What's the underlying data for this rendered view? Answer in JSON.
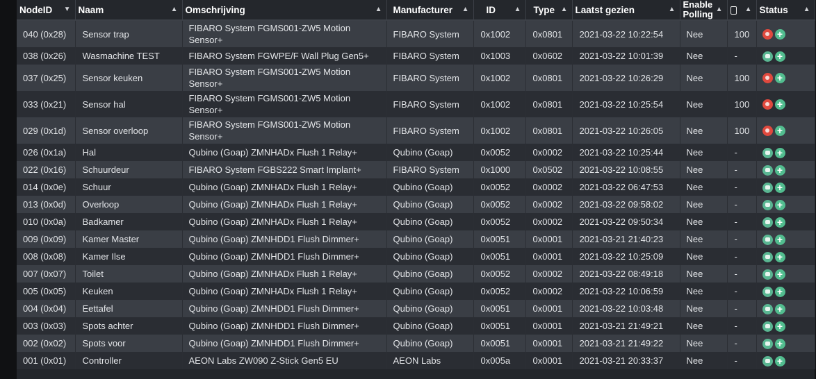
{
  "headers": {
    "nodeid": "NodeID",
    "naam": "Naam",
    "omschrijving": "Omschrijving",
    "manufacturer": "Manufacturer",
    "id": "ID",
    "type": "Type",
    "laatst": "Laatst gezien",
    "polling": "Enable Polling",
    "battery_icon": "battery-icon",
    "status": "Status"
  },
  "icons": {
    "sort": "sort-arrow-icon",
    "status_asleep": "status-warning-icon",
    "status_alive": "status-ok-icon",
    "add": "plus-circle-icon"
  },
  "colors": {
    "warning": "#e0493e",
    "ok": "#5ab692",
    "add": "#52bd8f"
  },
  "rows": [
    {
      "nodeid": "040 (0x28)",
      "naam": "Sensor trap",
      "omschrijving": "FIBARO System FGMS001-ZW5 Motion Sensor+",
      "manufacturer": "FIBARO System",
      "id": "0x1002",
      "type": "0x0801",
      "laatst": "2021-03-22 10:22:54",
      "polling": "Nee",
      "battery": "100",
      "status": "warn"
    },
    {
      "nodeid": "038 (0x26)",
      "naam": "Wasmachine TEST",
      "omschrijving": "FIBARO System FGWPE/F Wall Plug Gen5+",
      "manufacturer": "FIBARO System",
      "id": "0x1003",
      "type": "0x0602",
      "laatst": "2021-03-22 10:01:39",
      "polling": "Nee",
      "battery": "-",
      "status": "ok"
    },
    {
      "nodeid": "037 (0x25)",
      "naam": "Sensor keuken",
      "omschrijving": "FIBARO System FGMS001-ZW5 Motion Sensor+",
      "manufacturer": "FIBARO System",
      "id": "0x1002",
      "type": "0x0801",
      "laatst": "2021-03-22 10:26:29",
      "polling": "Nee",
      "battery": "100",
      "status": "warn"
    },
    {
      "nodeid": "033 (0x21)",
      "naam": "Sensor hal",
      "omschrijving": "FIBARO System FGMS001-ZW5 Motion Sensor+",
      "manufacturer": "FIBARO System",
      "id": "0x1002",
      "type": "0x0801",
      "laatst": "2021-03-22 10:25:54",
      "polling": "Nee",
      "battery": "100",
      "status": "warn"
    },
    {
      "nodeid": "029 (0x1d)",
      "naam": "Sensor overloop",
      "omschrijving": "FIBARO System FGMS001-ZW5 Motion Sensor+",
      "manufacturer": "FIBARO System",
      "id": "0x1002",
      "type": "0x0801",
      "laatst": "2021-03-22 10:26:05",
      "polling": "Nee",
      "battery": "100",
      "status": "warn"
    },
    {
      "nodeid": "026 (0x1a)",
      "naam": "Hal",
      "omschrijving": "Qubino (Goap) ZMNHADx Flush 1 Relay+",
      "manufacturer": "Qubino (Goap)",
      "id": "0x0052",
      "type": "0x0002",
      "laatst": "2021-03-22 10:25:44",
      "polling": "Nee",
      "battery": "-",
      "status": "ok"
    },
    {
      "nodeid": "022 (0x16)",
      "naam": "Schuurdeur",
      "omschrijving": "FIBARO System FGBS222 Smart Implant+",
      "manufacturer": "FIBARO System",
      "id": "0x1000",
      "type": "0x0502",
      "laatst": "2021-03-22 10:08:55",
      "polling": "Nee",
      "battery": "-",
      "status": "ok"
    },
    {
      "nodeid": "014 (0x0e)",
      "naam": "Schuur",
      "omschrijving": "Qubino (Goap) ZMNHADx Flush 1 Relay+",
      "manufacturer": "Qubino (Goap)",
      "id": "0x0052",
      "type": "0x0002",
      "laatst": "2021-03-22 06:47:53",
      "polling": "Nee",
      "battery": "-",
      "status": "ok"
    },
    {
      "nodeid": "013 (0x0d)",
      "naam": "Overloop",
      "omschrijving": "Qubino (Goap) ZMNHADx Flush 1 Relay+",
      "manufacturer": "Qubino (Goap)",
      "id": "0x0052",
      "type": "0x0002",
      "laatst": "2021-03-22 09:58:02",
      "polling": "Nee",
      "battery": "-",
      "status": "ok"
    },
    {
      "nodeid": "010 (0x0a)",
      "naam": "Badkamer",
      "omschrijving": "Qubino (Goap) ZMNHADx Flush 1 Relay+",
      "manufacturer": "Qubino (Goap)",
      "id": "0x0052",
      "type": "0x0002",
      "laatst": "2021-03-22 09:50:34",
      "polling": "Nee",
      "battery": "-",
      "status": "ok"
    },
    {
      "nodeid": "009 (0x09)",
      "naam": "Kamer Master",
      "omschrijving": "Qubino (Goap) ZMNHDD1 Flush Dimmer+",
      "manufacturer": "Qubino (Goap)",
      "id": "0x0051",
      "type": "0x0001",
      "laatst": "2021-03-21 21:40:23",
      "polling": "Nee",
      "battery": "-",
      "status": "ok"
    },
    {
      "nodeid": "008 (0x08)",
      "naam": "Kamer Ilse",
      "omschrijving": "Qubino (Goap) ZMNHDD1 Flush Dimmer+",
      "manufacturer": "Qubino (Goap)",
      "id": "0x0051",
      "type": "0x0001",
      "laatst": "2021-03-22 10:25:09",
      "polling": "Nee",
      "battery": "-",
      "status": "ok"
    },
    {
      "nodeid": "007 (0x07)",
      "naam": "Toilet",
      "omschrijving": "Qubino (Goap) ZMNHADx Flush 1 Relay+",
      "manufacturer": "Qubino (Goap)",
      "id": "0x0052",
      "type": "0x0002",
      "laatst": "2021-03-22 08:49:18",
      "polling": "Nee",
      "battery": "-",
      "status": "ok"
    },
    {
      "nodeid": "005 (0x05)",
      "naam": "Keuken",
      "omschrijving": "Qubino (Goap) ZMNHADx Flush 1 Relay+",
      "manufacturer": "Qubino (Goap)",
      "id": "0x0052",
      "type": "0x0002",
      "laatst": "2021-03-22 10:06:59",
      "polling": "Nee",
      "battery": "-",
      "status": "ok"
    },
    {
      "nodeid": "004 (0x04)",
      "naam": "Eettafel",
      "omschrijving": "Qubino (Goap) ZMNHDD1 Flush Dimmer+",
      "manufacturer": "Qubino (Goap)",
      "id": "0x0051",
      "type": "0x0001",
      "laatst": "2021-03-22 10:03:48",
      "polling": "Nee",
      "battery": "-",
      "status": "ok"
    },
    {
      "nodeid": "003 (0x03)",
      "naam": "Spots achter",
      "omschrijving": "Qubino (Goap) ZMNHDD1 Flush Dimmer+",
      "manufacturer": "Qubino (Goap)",
      "id": "0x0051",
      "type": "0x0001",
      "laatst": "2021-03-21 21:49:21",
      "polling": "Nee",
      "battery": "-",
      "status": "ok"
    },
    {
      "nodeid": "002 (0x02)",
      "naam": "Spots voor",
      "omschrijving": "Qubino (Goap) ZMNHDD1 Flush Dimmer+",
      "manufacturer": "Qubino (Goap)",
      "id": "0x0051",
      "type": "0x0001",
      "laatst": "2021-03-21 21:49:22",
      "polling": "Nee",
      "battery": "-",
      "status": "ok"
    },
    {
      "nodeid": "001 (0x01)",
      "naam": "Controller",
      "omschrijving": "AEON Labs ZW090 Z-Stick Gen5 EU",
      "manufacturer": "AEON Labs",
      "id": "0x005a",
      "type": "0x0001",
      "laatst": "2021-03-21 20:33:37",
      "polling": "Nee",
      "battery": "-",
      "status": "ok"
    }
  ]
}
